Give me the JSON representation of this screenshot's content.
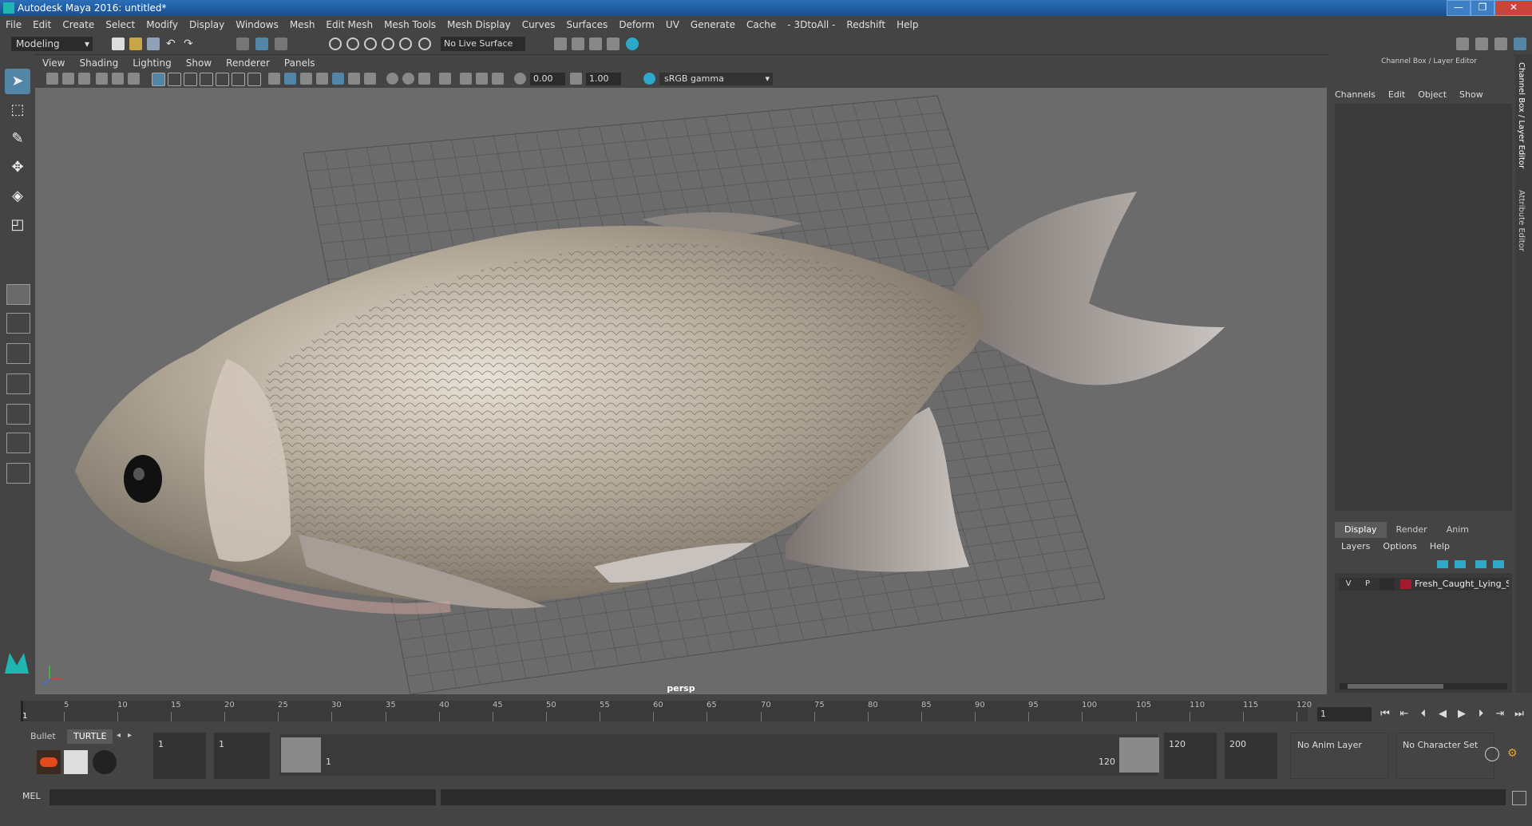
{
  "window": {
    "title": "Autodesk Maya 2016: untitled*",
    "min": "—",
    "max": "❐",
    "close": "✕"
  },
  "menubar": [
    "File",
    "Edit",
    "Create",
    "Select",
    "Modify",
    "Display",
    "Windows",
    "Mesh",
    "Edit Mesh",
    "Mesh Tools",
    "Mesh Display",
    "Curves",
    "Surfaces",
    "Deform",
    "UV",
    "Generate",
    "Cache",
    "- 3DtoAll -",
    "Redshift",
    "Help"
  ],
  "statusline": {
    "mode": "Modeling",
    "live_surface": "No Live Surface"
  },
  "panel": {
    "menu": [
      "View",
      "Shading",
      "Lighting",
      "Show",
      "Renderer",
      "Panels"
    ],
    "exposure": "0.00",
    "gamma_value": "1.00",
    "color_space": "sRGB gamma",
    "camera": "persp"
  },
  "channelbox": {
    "title": "Channel Box / Layer Editor",
    "menu": [
      "Channels",
      "Edit",
      "Object",
      "Show"
    ]
  },
  "layer_editor": {
    "tabs": [
      "Display",
      "Render",
      "Anim"
    ],
    "menu": [
      "Layers",
      "Options",
      "Help"
    ],
    "layer": {
      "v": "V",
      "p": "P",
      "name": "Fresh_Caught_Lying_Silv",
      "color": "#a31a2f"
    }
  },
  "side_tabs": [
    "Channel Box / Layer Editor",
    "Attribute Editor"
  ],
  "timeslider": {
    "ticks": [
      "5",
      "10",
      "15",
      "20",
      "25",
      "30",
      "35",
      "40",
      "45",
      "50",
      "55",
      "60",
      "65",
      "70",
      "75",
      "80",
      "85",
      "90",
      "95",
      "100",
      "105",
      "110",
      "115",
      "120"
    ],
    "first": "1",
    "last": "120",
    "current_frame": "1"
  },
  "shelf": {
    "tabs": [
      "Bullet",
      "TURTLE"
    ]
  },
  "range": {
    "start": "1",
    "playback_start": "1",
    "handle_start": "1",
    "handle_end": "120",
    "playback_end": "120",
    "end": "200",
    "anim_layer": "No Anim Layer",
    "character_set": "No Character Set"
  },
  "cmdline": {
    "label": "MEL"
  }
}
